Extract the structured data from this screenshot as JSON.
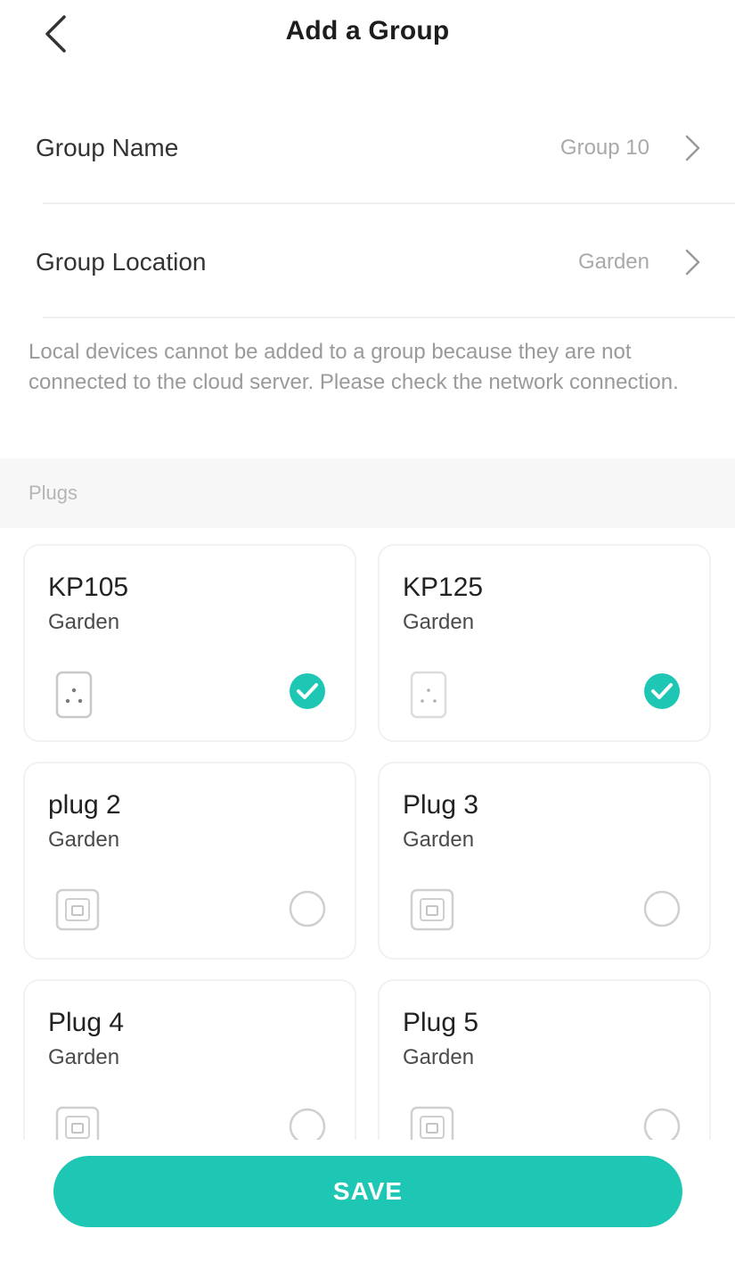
{
  "header": {
    "title": "Add a Group",
    "back_icon": "chevron-left-icon"
  },
  "settings": [
    {
      "label": "Group Name",
      "value": "Group 10"
    },
    {
      "label": "Group Location",
      "value": "Garden"
    }
  ],
  "note": "Local devices cannot be added to a group because they are not connected to the cloud server. Please check the network connection.",
  "section": {
    "title": "Plugs"
  },
  "devices": [
    {
      "name": "KP105",
      "location": "Garden",
      "icon": "mini-plug-icon",
      "selected": true
    },
    {
      "name": "KP125",
      "location": "Garden",
      "icon": "mini-plug-icon",
      "selected": true
    },
    {
      "name": "plug 2",
      "location": "Garden",
      "icon": "outlet-plug-icon",
      "selected": false
    },
    {
      "name": "Plug 3",
      "location": "Garden",
      "icon": "outlet-plug-icon",
      "selected": false
    },
    {
      "name": "Plug 4",
      "location": "Garden",
      "icon": "outlet-plug-icon",
      "selected": false
    },
    {
      "name": "Plug 5",
      "location": "Garden",
      "icon": "outlet-plug-icon",
      "selected": false
    }
  ],
  "save_label": "SAVE",
  "colors": {
    "accent": "#1ec7b4",
    "muted_text": "#a9a9a9",
    "section_bg": "#f7f7f7"
  }
}
